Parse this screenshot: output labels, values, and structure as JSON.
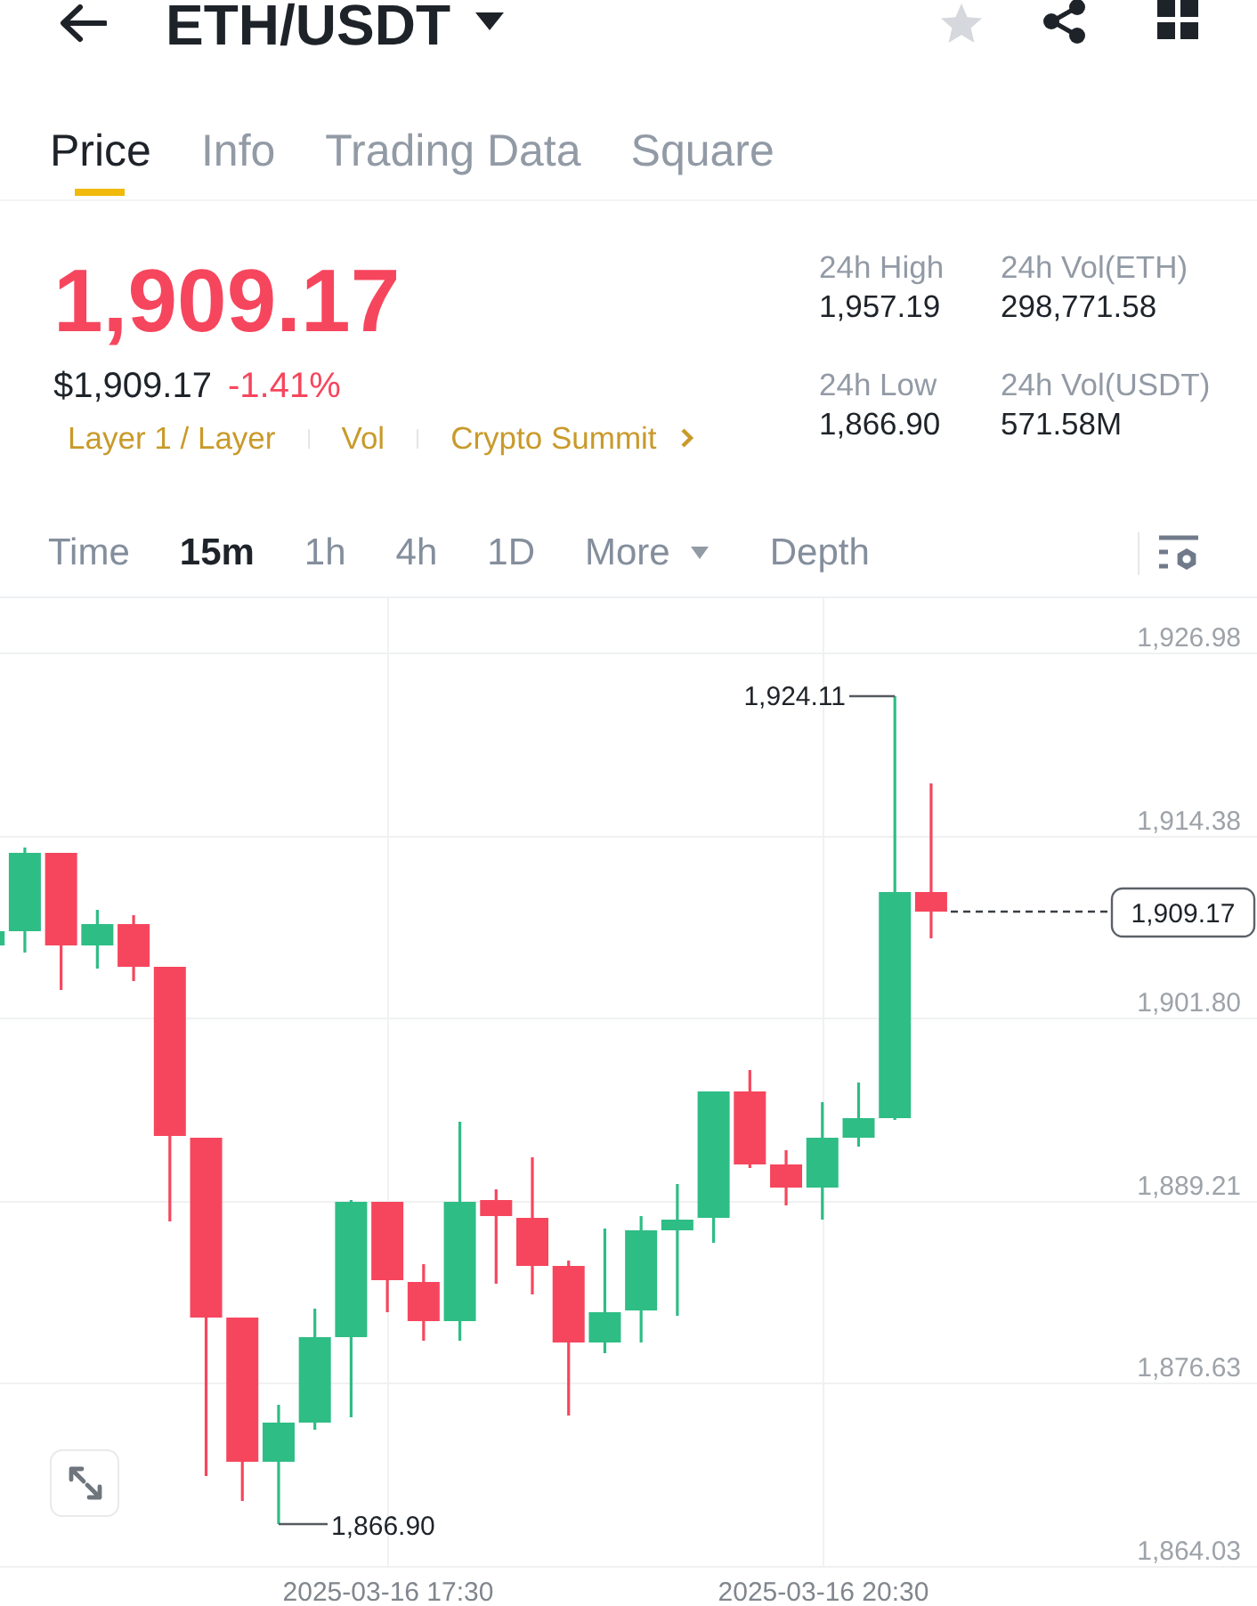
{
  "header": {
    "pair": "ETH/USDT",
    "favorited": false
  },
  "tabs": [
    {
      "label": "Price",
      "selected": true
    },
    {
      "label": "Info",
      "selected": false
    },
    {
      "label": "Trading Data",
      "selected": false
    },
    {
      "label": "Square",
      "selected": false
    }
  ],
  "price": {
    "last": "1,909.17",
    "fiat": "$1,909.17",
    "change": "-1.41%"
  },
  "tags": [
    "Layer 1 / Layer",
    "Vol",
    "Crypto Summit"
  ],
  "stats": [
    {
      "label": "24h High",
      "value": "1,957.19"
    },
    {
      "label": "24h Vol(ETH)",
      "value": "298,771.58"
    },
    {
      "label": "24h Low",
      "value": "1,866.90"
    },
    {
      "label": "24h Vol(USDT)",
      "value": "571.58M"
    }
  ],
  "intervals": [
    {
      "label": "Time",
      "kind": "option",
      "selected": false
    },
    {
      "label": "15m",
      "kind": "option",
      "selected": true
    },
    {
      "label": "1h",
      "kind": "option",
      "selected": false
    },
    {
      "label": "4h",
      "kind": "option",
      "selected": false
    },
    {
      "label": "1D",
      "kind": "option",
      "selected": false
    },
    {
      "label": "More",
      "kind": "dropdown",
      "selected": false
    },
    {
      "label": "Depth",
      "kind": "option",
      "selected": false
    }
  ],
  "chart": {
    "y_axis_labels": [
      "1,926.98",
      "1,914.38",
      "1,901.80",
      "1,889.21",
      "1,876.63",
      "1,864.03"
    ],
    "x_axis_labels": [
      "2025-03-16 17:30",
      "2025-03-16 20:30"
    ],
    "high_label": "1,924.11",
    "low_label": "1,866.90",
    "last_price": "1,909.17"
  }
}
